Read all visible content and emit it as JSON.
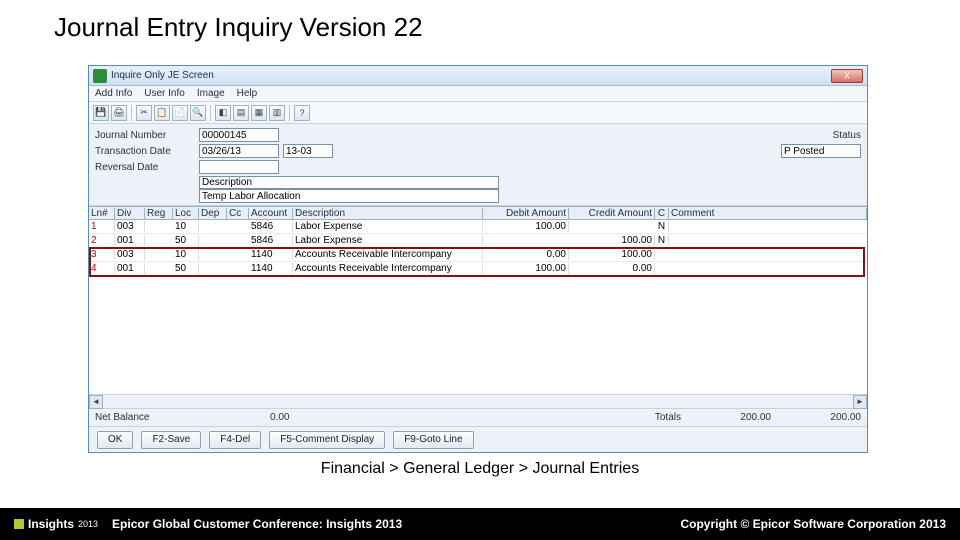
{
  "slide": {
    "title": "Journal Entry Inquiry Version 22",
    "breadcrumb": "Financial > General Ledger > Journal Entries",
    "footer_conf": "Epicor Global Customer Conference: Insights 2013",
    "footer_right": "Copyright © Epicor Software Corporation 2013",
    "logo_text": "Insights",
    "logo_year": "2013"
  },
  "window": {
    "title": "Inquire Only JE Screen",
    "close_x": "X"
  },
  "menu": {
    "add": "Add Info",
    "user": "User Info",
    "image": "Image",
    "help": "Help"
  },
  "toolbar_icons": [
    "💾",
    "🖨",
    "│",
    "✂",
    "📋",
    "📄",
    "🔍",
    "│",
    "◧",
    "▤",
    "▦",
    "▥",
    "│",
    "?"
  ],
  "form": {
    "jn_label": "Journal Number",
    "jn_value": "00000145",
    "td_label": "Transaction Date",
    "td_value": "03/26/13",
    "period_value": "13-03",
    "rd_label": "Reversal Date",
    "status_label": "Status",
    "status_value": "P Posted",
    "desc_label": "Description",
    "desc_value": "Temp Labor Allocation"
  },
  "grid": {
    "headers": {
      "ln": "Ln#",
      "div": "Div",
      "reg": "Reg",
      "loc": "Loc",
      "dep": "Dep",
      "cc": "Cc",
      "acc": "Account",
      "desc": "Description",
      "deb": "Debit Amount",
      "cred": "Credit Amount",
      "c": "C",
      "com": "Comment"
    },
    "rows": [
      {
        "ln": "1",
        "div": "003",
        "reg": "",
        "loc": "10",
        "dep": "",
        "cc": "",
        "acc": "5846",
        "desc": "Labor Expense",
        "deb": "100.00",
        "cred": "",
        "c": "N",
        "com": ""
      },
      {
        "ln": "2",
        "div": "001",
        "reg": "",
        "loc": "50",
        "dep": "",
        "cc": "",
        "acc": "5846",
        "desc": "Labor Expense",
        "deb": "",
        "cred": "100.00",
        "c": "N",
        "com": ""
      },
      {
        "ln": "3",
        "div": "003",
        "reg": "",
        "loc": "10",
        "dep": "",
        "cc": "",
        "acc": "1140",
        "desc": "Accounts Receivable Intercompany",
        "deb": "0.00",
        "cred": "100.00",
        "c": "",
        "com": ""
      },
      {
        "ln": "4",
        "div": "001",
        "reg": "",
        "loc": "50",
        "dep": "",
        "cc": "",
        "acc": "1140",
        "desc": "Accounts Receivable Intercompany",
        "deb": "100.00",
        "cred": "0.00",
        "c": "",
        "com": ""
      }
    ]
  },
  "footer": {
    "nb_label": "Net Balance",
    "nb_value": "0.00",
    "tot_label": "Totals",
    "tot_deb": "200.00",
    "tot_cred": "200.00"
  },
  "buttons": {
    "ok": "OK",
    "f2": "F2-Save",
    "f4": "F4-Del",
    "f5": "F5-Comment Display",
    "f9": "F9-Goto Line"
  }
}
